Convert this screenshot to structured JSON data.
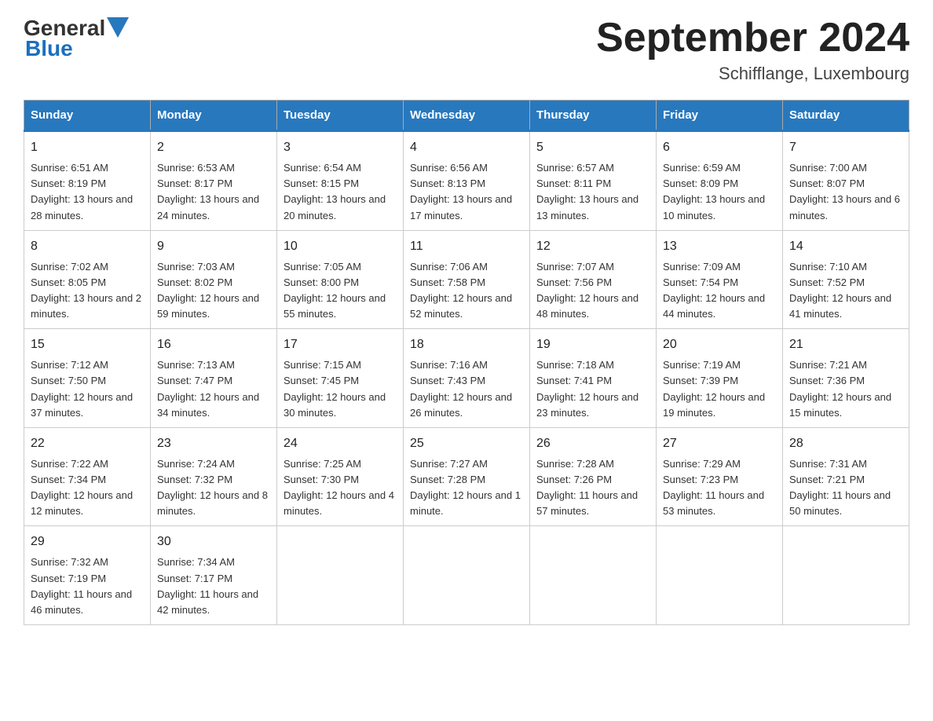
{
  "logo": {
    "text_general": "General",
    "text_blue": "Blue"
  },
  "title": "September 2024",
  "subtitle": "Schifflange, Luxembourg",
  "days_of_week": [
    "Sunday",
    "Monday",
    "Tuesday",
    "Wednesday",
    "Thursday",
    "Friday",
    "Saturday"
  ],
  "weeks": [
    [
      {
        "day": "1",
        "sunrise": "Sunrise: 6:51 AM",
        "sunset": "Sunset: 8:19 PM",
        "daylight": "Daylight: 13 hours and 28 minutes."
      },
      {
        "day": "2",
        "sunrise": "Sunrise: 6:53 AM",
        "sunset": "Sunset: 8:17 PM",
        "daylight": "Daylight: 13 hours and 24 minutes."
      },
      {
        "day": "3",
        "sunrise": "Sunrise: 6:54 AM",
        "sunset": "Sunset: 8:15 PM",
        "daylight": "Daylight: 13 hours and 20 minutes."
      },
      {
        "day": "4",
        "sunrise": "Sunrise: 6:56 AM",
        "sunset": "Sunset: 8:13 PM",
        "daylight": "Daylight: 13 hours and 17 minutes."
      },
      {
        "day": "5",
        "sunrise": "Sunrise: 6:57 AM",
        "sunset": "Sunset: 8:11 PM",
        "daylight": "Daylight: 13 hours and 13 minutes."
      },
      {
        "day": "6",
        "sunrise": "Sunrise: 6:59 AM",
        "sunset": "Sunset: 8:09 PM",
        "daylight": "Daylight: 13 hours and 10 minutes."
      },
      {
        "day": "7",
        "sunrise": "Sunrise: 7:00 AM",
        "sunset": "Sunset: 8:07 PM",
        "daylight": "Daylight: 13 hours and 6 minutes."
      }
    ],
    [
      {
        "day": "8",
        "sunrise": "Sunrise: 7:02 AM",
        "sunset": "Sunset: 8:05 PM",
        "daylight": "Daylight: 13 hours and 2 minutes."
      },
      {
        "day": "9",
        "sunrise": "Sunrise: 7:03 AM",
        "sunset": "Sunset: 8:02 PM",
        "daylight": "Daylight: 12 hours and 59 minutes."
      },
      {
        "day": "10",
        "sunrise": "Sunrise: 7:05 AM",
        "sunset": "Sunset: 8:00 PM",
        "daylight": "Daylight: 12 hours and 55 minutes."
      },
      {
        "day": "11",
        "sunrise": "Sunrise: 7:06 AM",
        "sunset": "Sunset: 7:58 PM",
        "daylight": "Daylight: 12 hours and 52 minutes."
      },
      {
        "day": "12",
        "sunrise": "Sunrise: 7:07 AM",
        "sunset": "Sunset: 7:56 PM",
        "daylight": "Daylight: 12 hours and 48 minutes."
      },
      {
        "day": "13",
        "sunrise": "Sunrise: 7:09 AM",
        "sunset": "Sunset: 7:54 PM",
        "daylight": "Daylight: 12 hours and 44 minutes."
      },
      {
        "day": "14",
        "sunrise": "Sunrise: 7:10 AM",
        "sunset": "Sunset: 7:52 PM",
        "daylight": "Daylight: 12 hours and 41 minutes."
      }
    ],
    [
      {
        "day": "15",
        "sunrise": "Sunrise: 7:12 AM",
        "sunset": "Sunset: 7:50 PM",
        "daylight": "Daylight: 12 hours and 37 minutes."
      },
      {
        "day": "16",
        "sunrise": "Sunrise: 7:13 AM",
        "sunset": "Sunset: 7:47 PM",
        "daylight": "Daylight: 12 hours and 34 minutes."
      },
      {
        "day": "17",
        "sunrise": "Sunrise: 7:15 AM",
        "sunset": "Sunset: 7:45 PM",
        "daylight": "Daylight: 12 hours and 30 minutes."
      },
      {
        "day": "18",
        "sunrise": "Sunrise: 7:16 AM",
        "sunset": "Sunset: 7:43 PM",
        "daylight": "Daylight: 12 hours and 26 minutes."
      },
      {
        "day": "19",
        "sunrise": "Sunrise: 7:18 AM",
        "sunset": "Sunset: 7:41 PM",
        "daylight": "Daylight: 12 hours and 23 minutes."
      },
      {
        "day": "20",
        "sunrise": "Sunrise: 7:19 AM",
        "sunset": "Sunset: 7:39 PM",
        "daylight": "Daylight: 12 hours and 19 minutes."
      },
      {
        "day": "21",
        "sunrise": "Sunrise: 7:21 AM",
        "sunset": "Sunset: 7:36 PM",
        "daylight": "Daylight: 12 hours and 15 minutes."
      }
    ],
    [
      {
        "day": "22",
        "sunrise": "Sunrise: 7:22 AM",
        "sunset": "Sunset: 7:34 PM",
        "daylight": "Daylight: 12 hours and 12 minutes."
      },
      {
        "day": "23",
        "sunrise": "Sunrise: 7:24 AM",
        "sunset": "Sunset: 7:32 PM",
        "daylight": "Daylight: 12 hours and 8 minutes."
      },
      {
        "day": "24",
        "sunrise": "Sunrise: 7:25 AM",
        "sunset": "Sunset: 7:30 PM",
        "daylight": "Daylight: 12 hours and 4 minutes."
      },
      {
        "day": "25",
        "sunrise": "Sunrise: 7:27 AM",
        "sunset": "Sunset: 7:28 PM",
        "daylight": "Daylight: 12 hours and 1 minute."
      },
      {
        "day": "26",
        "sunrise": "Sunrise: 7:28 AM",
        "sunset": "Sunset: 7:26 PM",
        "daylight": "Daylight: 11 hours and 57 minutes."
      },
      {
        "day": "27",
        "sunrise": "Sunrise: 7:29 AM",
        "sunset": "Sunset: 7:23 PM",
        "daylight": "Daylight: 11 hours and 53 minutes."
      },
      {
        "day": "28",
        "sunrise": "Sunrise: 7:31 AM",
        "sunset": "Sunset: 7:21 PM",
        "daylight": "Daylight: 11 hours and 50 minutes."
      }
    ],
    [
      {
        "day": "29",
        "sunrise": "Sunrise: 7:32 AM",
        "sunset": "Sunset: 7:19 PM",
        "daylight": "Daylight: 11 hours and 46 minutes."
      },
      {
        "day": "30",
        "sunrise": "Sunrise: 7:34 AM",
        "sunset": "Sunset: 7:17 PM",
        "daylight": "Daylight: 11 hours and 42 minutes."
      },
      {
        "day": "",
        "sunrise": "",
        "sunset": "",
        "daylight": ""
      },
      {
        "day": "",
        "sunrise": "",
        "sunset": "",
        "daylight": ""
      },
      {
        "day": "",
        "sunrise": "",
        "sunset": "",
        "daylight": ""
      },
      {
        "day": "",
        "sunrise": "",
        "sunset": "",
        "daylight": ""
      },
      {
        "day": "",
        "sunrise": "",
        "sunset": "",
        "daylight": ""
      }
    ]
  ]
}
